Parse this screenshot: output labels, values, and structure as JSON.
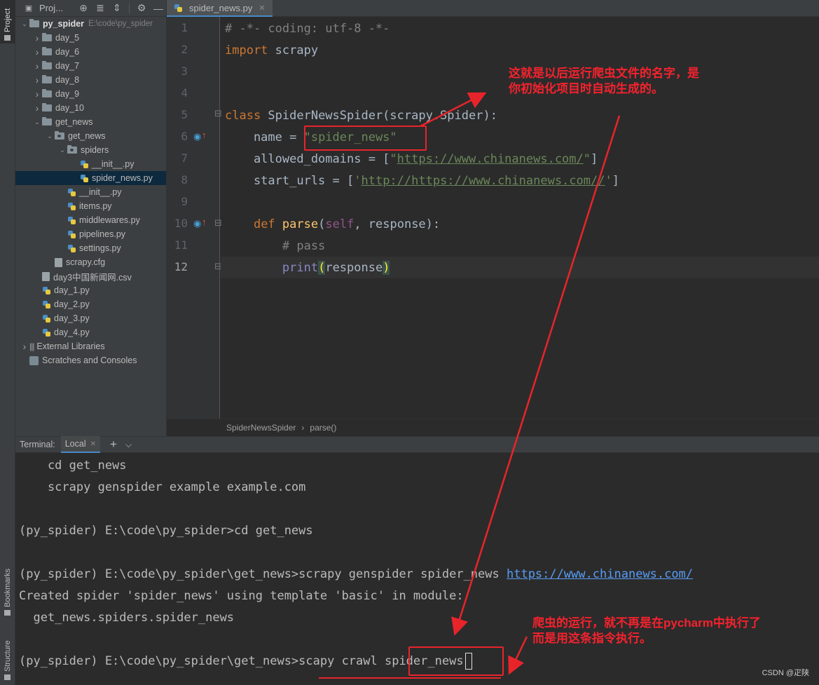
{
  "toolstrip": {
    "project_label": "Project",
    "bookmarks_label": "Bookmarks",
    "structure_label": "Structure"
  },
  "project": {
    "header_label": "Proj...",
    "tree": [
      {
        "label": "py_spider",
        "hint": "E:\\code\\py_spider",
        "kind": "folder",
        "depth": 0,
        "arrow": "open"
      },
      {
        "label": "day_5",
        "kind": "folder",
        "depth": 1,
        "arrow": "closed"
      },
      {
        "label": "day_6",
        "kind": "folder",
        "depth": 1,
        "arrow": "closed"
      },
      {
        "label": "day_7",
        "kind": "folder",
        "depth": 1,
        "arrow": "closed"
      },
      {
        "label": "day_8",
        "kind": "folder",
        "depth": 1,
        "arrow": "closed"
      },
      {
        "label": "day_9",
        "kind": "folder",
        "depth": 1,
        "arrow": "closed"
      },
      {
        "label": "day_10",
        "kind": "folder",
        "depth": 1,
        "arrow": "closed"
      },
      {
        "label": "get_news",
        "kind": "folder",
        "depth": 1,
        "arrow": "open"
      },
      {
        "label": "get_news",
        "kind": "package",
        "depth": 2,
        "arrow": "open"
      },
      {
        "label": "spiders",
        "kind": "package",
        "depth": 3,
        "arrow": "open"
      },
      {
        "label": "__init__.py",
        "kind": "py",
        "depth": 4
      },
      {
        "label": "spider_news.py",
        "kind": "py",
        "depth": 4,
        "selected": true
      },
      {
        "label": "__init__.py",
        "kind": "py",
        "depth": 3
      },
      {
        "label": "items.py",
        "kind": "py",
        "depth": 3
      },
      {
        "label": "middlewares.py",
        "kind": "py",
        "depth": 3
      },
      {
        "label": "pipelines.py",
        "kind": "py",
        "depth": 3
      },
      {
        "label": "settings.py",
        "kind": "py",
        "depth": 3
      },
      {
        "label": "scrapy.cfg",
        "kind": "file",
        "depth": 2
      },
      {
        "label": "day3中国新闻网.csv",
        "kind": "file",
        "depth": 1
      },
      {
        "label": "day_1.py",
        "kind": "py",
        "depth": 1
      },
      {
        "label": "day_2.py",
        "kind": "py",
        "depth": 1
      },
      {
        "label": "day_3.py",
        "kind": "py",
        "depth": 1
      },
      {
        "label": "day_4.py",
        "kind": "py",
        "depth": 1
      },
      {
        "label": "External Libraries",
        "kind": "lib",
        "depth": 0,
        "arrow": "closed"
      },
      {
        "label": "Scratches and Consoles",
        "kind": "scratch",
        "depth": 0
      }
    ]
  },
  "editor": {
    "tab_label": "spider_news.py",
    "line_numbers": [
      "1",
      "2",
      "3",
      "4",
      "5",
      "6",
      "7",
      "8",
      "9",
      "10",
      "11",
      "12"
    ],
    "code": {
      "l1": "# -*- coding: utf-8 -*-",
      "l2_kw": "import",
      "l2_rest": " scrapy",
      "l5_kw": "class",
      "l5_name": " SpiderNewsSpider(scrapy.Spider):",
      "l6_a": "    name = ",
      "l6_str": "\"spider_news\"",
      "l7_a": "    allowed_domains = [",
      "l7_q1": "\"",
      "l7_url": "https://www.chinanews.com/",
      "l7_q2": "\"",
      "l7_b": "]",
      "l8_a": "    start_urls = [",
      "l8_q1": "'",
      "l8_url": "http://https://www.chinanews.com//",
      "l8_q2": "'",
      "l8_b": "]",
      "l10_indent": "    ",
      "l10_kw": "def",
      "l10_sp": " ",
      "l10_fn": "parse",
      "l10_o": "(",
      "l10_self": "self",
      "l10_rest": ", response):",
      "l11": "        # pass",
      "l12_indent": "        ",
      "l12_fn": "print",
      "l12_o": "(",
      "l12_arg": "response",
      "l12_c": ")"
    },
    "breadcrumb": [
      "SpiderNewsSpider",
      "parse()"
    ]
  },
  "terminal": {
    "title": "Terminal:",
    "tab_label": "Local",
    "lines": {
      "t1": "    cd get_news",
      "t2": "    scrapy genspider example example.com",
      "t3": "(py_spider) E:\\code\\py_spider>cd get_news",
      "t4_a": "(py_spider) E:\\code\\py_spider\\get_news>scrapy genspider spider_news ",
      "t4_link": "https://www.chinanews.com/",
      "t5": "Created spider 'spider_news' using template 'basic' in module:",
      "t6": "  get_news.spiders.spider_news",
      "t7": "(py_spider) E:\\code\\py_spider\\get_news>scapy crawl spider_news"
    }
  },
  "annotations": {
    "note_top_1": "这就是以后运行爬虫文件的名字，是",
    "note_top_2": "你初始化项目时自动生成的。",
    "note_bottom_1": "爬虫的运行，就不再是在pycharm中执行了",
    "note_bottom_2": "而是用这条指令执行。",
    "color": "#f5222d"
  },
  "watermark": "CSDN @疋陕"
}
